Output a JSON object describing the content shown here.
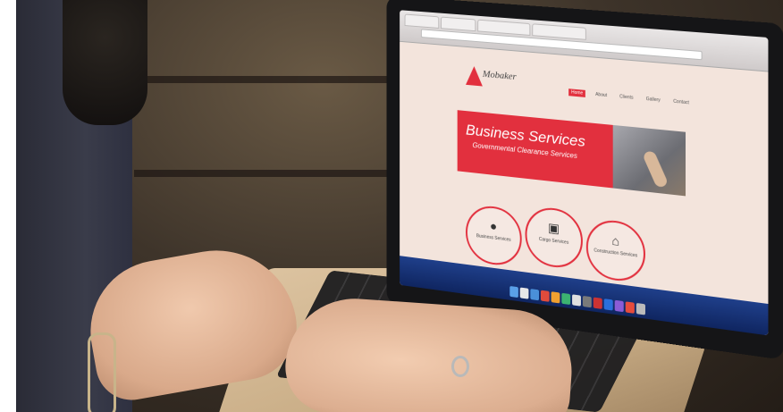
{
  "browser": {
    "tabs": [
      "",
      "",
      "",
      ""
    ],
    "address": ""
  },
  "site": {
    "logo_text": "Mobaker",
    "logo_sub": "",
    "nav": [
      "Home",
      "About",
      "Clients",
      "Gallery",
      "Contact"
    ],
    "banner_title": "Business Services",
    "banner_subtitle": "Governmental Clearance Services",
    "services": [
      {
        "label": "Business Services",
        "icon": "person-icon"
      },
      {
        "label": "Cargo Services",
        "icon": "truck-icon"
      },
      {
        "label": "Construction Services",
        "icon": "house-icon"
      }
    ]
  },
  "colors": {
    "brand_red": "#e2303e",
    "page_bg": "#f3e4dc",
    "dock_blue": "#1f3f8a"
  }
}
